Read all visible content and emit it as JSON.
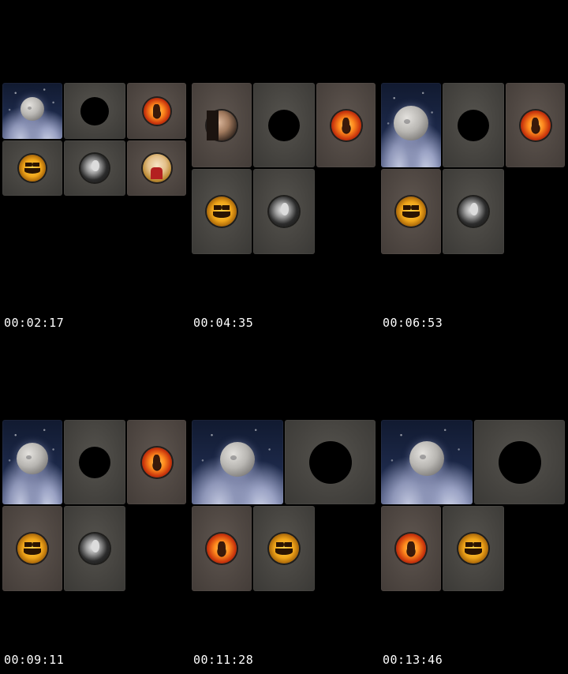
{
  "frames": [
    {
      "timestamp": "00:02:17",
      "tiles": [
        {
          "type": "moon",
          "label": "moon-tile"
        },
        {
          "type": "blank",
          "label": "blank-tile"
        },
        {
          "type": "demon",
          "label": "demon-tile"
        },
        {
          "type": "pumpkin",
          "label": "pumpkin-tile"
        },
        {
          "type": "woman",
          "label": "woman-tile"
        },
        {
          "type": "man",
          "label": "man-tile"
        }
      ]
    },
    {
      "timestamp": "00:04:35",
      "tiles": [
        {
          "type": "face",
          "label": "face-tile"
        },
        {
          "type": "blank",
          "label": "blank-tile"
        },
        {
          "type": "demon",
          "label": "demon-tile"
        },
        {
          "type": "pumpkin",
          "label": "pumpkin-tile"
        },
        {
          "type": "woman",
          "label": "woman-tile"
        }
      ]
    },
    {
      "timestamp": "00:06:53",
      "tiles": [
        {
          "type": "moon",
          "label": "moon-tile"
        },
        {
          "type": "blank",
          "label": "blank-tile"
        },
        {
          "type": "demon",
          "label": "demon-tile"
        },
        {
          "type": "pumpkin",
          "label": "pumpkin-tile"
        },
        {
          "type": "woman",
          "label": "woman-tile"
        }
      ]
    },
    {
      "timestamp": "00:09:11",
      "tiles": [
        {
          "type": "moon",
          "label": "moon-tile"
        },
        {
          "type": "blank",
          "label": "blank-tile"
        },
        {
          "type": "demon",
          "label": "demon-tile"
        },
        {
          "type": "pumpkin",
          "label": "pumpkin-tile"
        },
        {
          "type": "woman",
          "label": "woman-tile"
        }
      ]
    },
    {
      "timestamp": "00:11:28",
      "tiles": [
        {
          "type": "moon",
          "label": "moon-tile"
        },
        {
          "type": "blank",
          "label": "blank-tile"
        },
        {
          "type": "demon",
          "label": "demon-tile"
        },
        {
          "type": "pumpkin",
          "label": "pumpkin-tile"
        }
      ]
    },
    {
      "timestamp": "00:13:46",
      "tiles": [
        {
          "type": "moon",
          "label": "moon-tile"
        },
        {
          "type": "blank",
          "label": "blank-tile"
        },
        {
          "type": "demon",
          "label": "demon-tile"
        },
        {
          "type": "pumpkin",
          "label": "pumpkin-tile"
        }
      ]
    }
  ],
  "colors": {
    "background": "#000000",
    "timestamp_text": "#ffffff",
    "tile_gray": "#464440",
    "tile_warm": "#4f4742"
  }
}
